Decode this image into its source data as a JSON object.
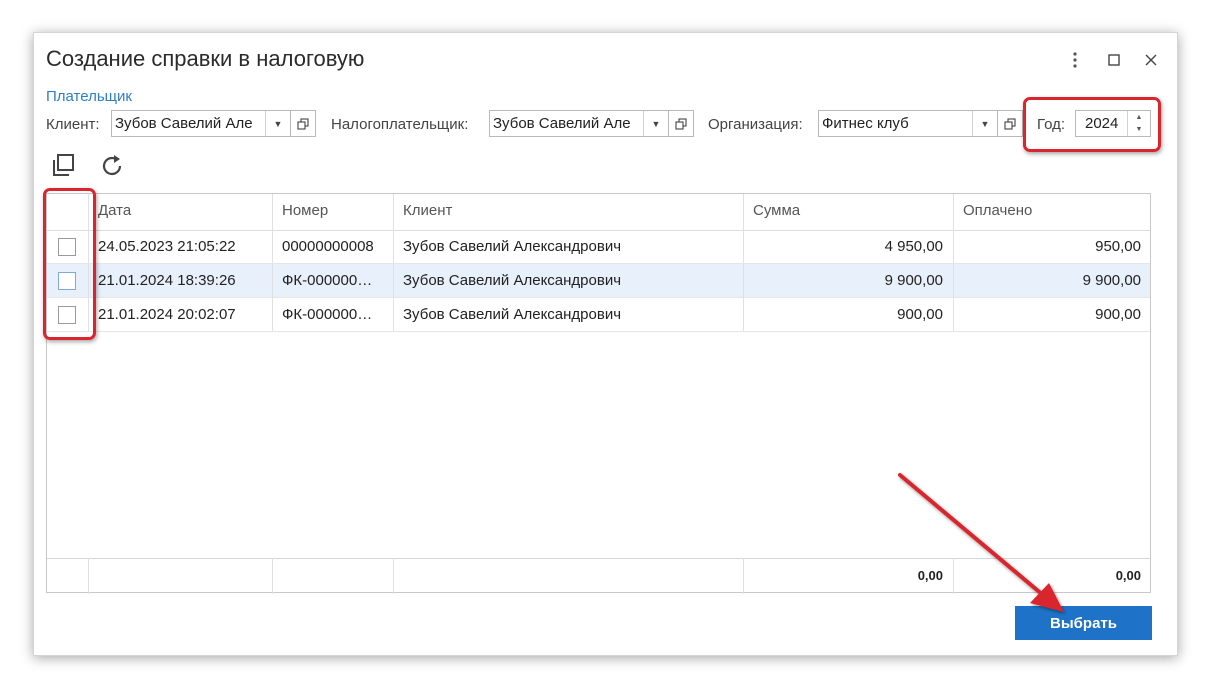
{
  "dialog": {
    "title": "Создание справки в налоговую",
    "menu_icon": "more-vertical-icon",
    "maximize_icon": "maximize-icon",
    "close_icon": "close-icon"
  },
  "payer_link": "Плательщик",
  "filters": {
    "client_label": "Клиент:",
    "client_value": "Зубов Савелий Але",
    "taxpayer_label": "Налогоплательщик:",
    "taxpayer_value": "Зубов Савелий Але",
    "org_label": "Организация:",
    "org_value": "Фитнес клуб",
    "year_label": "Год:",
    "year_value": "2024"
  },
  "toolbar": {
    "copy_icon": "copy-icon",
    "refresh_icon": "refresh-icon"
  },
  "table": {
    "columns": [
      "Дата",
      "Номер",
      "Клиент",
      "Сумма",
      "Оплачено"
    ],
    "rows": [
      {
        "date": "24.05.2023 21:05:22",
        "number": "00000000008",
        "client": "Зубов Савелий Александрович",
        "sum": "4 950,00",
        "paid": "950,00",
        "checked": false
      },
      {
        "date": "21.01.2024 18:39:26",
        "number": "ФК-000000…",
        "client": "Зубов Савелий Александрович",
        "sum": "9 900,00",
        "paid": "9 900,00",
        "checked": false
      },
      {
        "date": "21.01.2024 20:02:07",
        "number": "ФК-000000…",
        "client": "Зубов Савелий Александрович",
        "sum": "900,00",
        "paid": "900,00",
        "checked": false
      }
    ],
    "footer": {
      "sum_total": "0,00",
      "paid_total": "0,00"
    }
  },
  "select_button": "Выбрать",
  "colors": {
    "accent": "#1e73c8",
    "highlight": "#d9262e",
    "selected_row": "#e8f0fb"
  }
}
